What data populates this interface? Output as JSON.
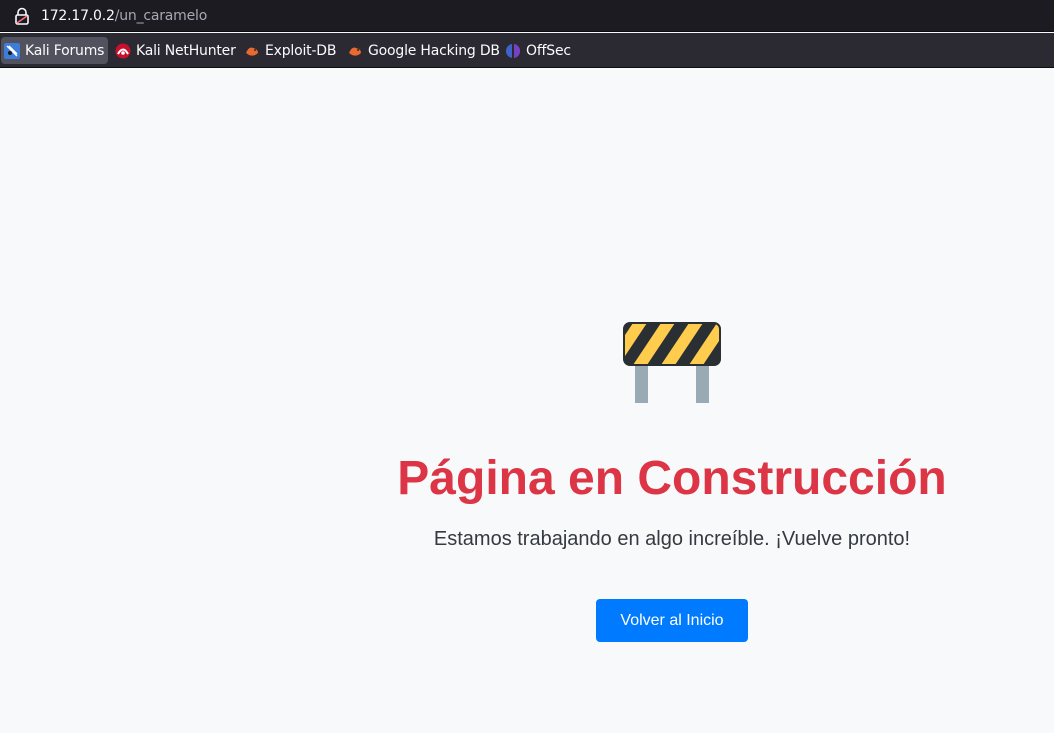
{
  "browser": {
    "url_host": "172.17.0.2",
    "url_path": "/un_caramelo",
    "bookmarks": [
      {
        "label": "Kali Forums",
        "icon": "kali-forums-icon"
      },
      {
        "label": "Kali NetHunter",
        "icon": "nethunter-icon"
      },
      {
        "label": "Exploit-DB",
        "icon": "exploit-db-icon"
      },
      {
        "label": "Google Hacking DB",
        "icon": "ghdb-icon"
      },
      {
        "label": "OffSec",
        "icon": "offsec-icon"
      }
    ]
  },
  "main": {
    "icon": "construction-barrier-icon",
    "title": "Página en Construcción",
    "subtitle": "Estamos trabajando en algo increíble. ¡Vuelve pronto!",
    "button_label": "Volver al Inicio"
  },
  "colors": {
    "title": "#dc3545",
    "button": "#007bff",
    "background": "#f8f9fa",
    "barrier_yellow": "#ffcc4d",
    "barrier_black": "#292f33",
    "barrier_legs": "#99aab5"
  }
}
